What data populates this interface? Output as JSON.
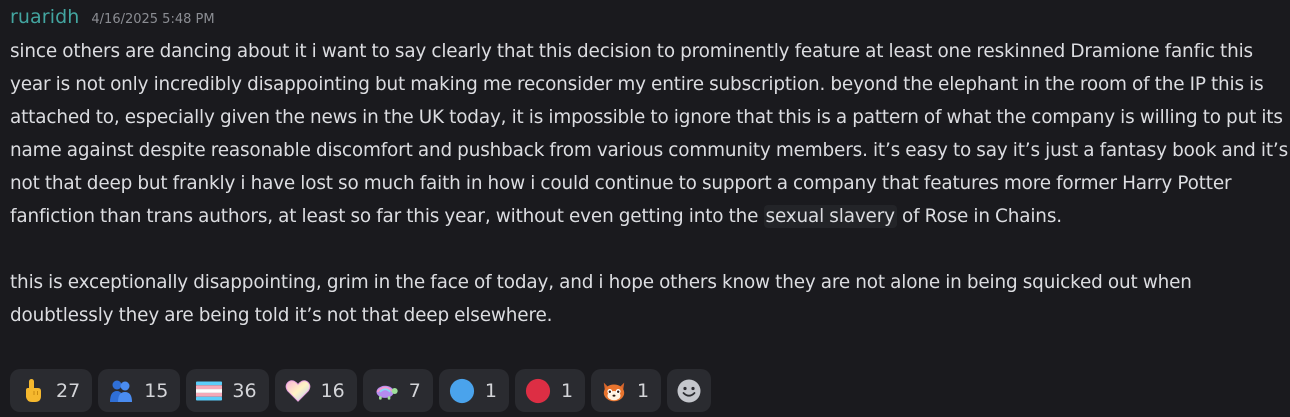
{
  "message": {
    "username": "ruaridh",
    "timestamp": "4/16/2025 5:48 PM",
    "paragraph1_before": "since others are dancing about it i want to say clearly that this decision to prominently feature at least one reskinned Dramione fanfic this year is not only incredibly disappointing but making me reconsider my entire subscription. beyond the elephant in the room of the IP this is attached to, especially given the news in the UK today, it is impossible to ignore that this is a pattern of what the company is willing to put its name against despite reasonable discomfort and pushback from various community members. it’s easy to say it’s just a fantasy book and it’s not that deep but frankly i have lost so much faith in how i could continue to support a company that features more former Harry Potter fanfiction than trans authors, at least so far this year, without even getting into the ",
    "paragraph1_spoiler": "sexual slavery",
    "paragraph1_after": " of Rose in Chains.",
    "paragraph2": "this is exceptionally disappointing, grim in the face of today, and i hope others know they are not alone in being squicked out when doubtlessly they are being told it’s not that deep elsewhere."
  },
  "reactions": [
    {
      "icon": "pointing-up-hand-icon",
      "count": "27"
    },
    {
      "icon": "people-hugging-icon",
      "count": "15"
    },
    {
      "icon": "transgender-flag-icon",
      "count": "36"
    },
    {
      "icon": "pastel-heart-icon",
      "count": "16"
    },
    {
      "icon": "rainbow-turtle-icon",
      "count": "7"
    },
    {
      "icon": "blue-circle-icon",
      "count": "1"
    },
    {
      "icon": "red-circle-icon",
      "count": "1"
    },
    {
      "icon": "red-panda-icon",
      "count": "1"
    }
  ],
  "colors": {
    "background": "#1a1a1e",
    "username": "#43a5a0",
    "text": "#dcdde1",
    "reaction_bg": "#2a2b30"
  }
}
